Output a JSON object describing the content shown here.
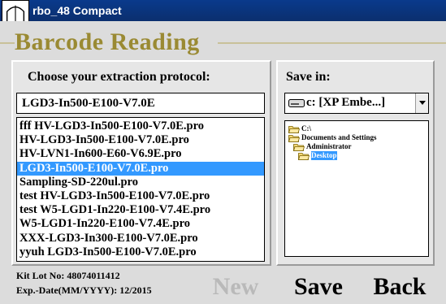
{
  "window": {
    "title": "rbo_48 Compact"
  },
  "header": {
    "title": "Barcode Reading"
  },
  "protocol_panel": {
    "label": "Choose your extraction protocol:",
    "current_value": "LGD3-In500-E100-V7.0E",
    "items": [
      "fff HV-LGD3-In500-E100-V7.0E.pro",
      "HV-LGD3-In500-E100-V7.0E.pro",
      "HV-LVN1-In600-E60-V6.9E.pro",
      "LGD3-In500-E100-V7.0E.pro",
      "Sampling-SD-220ul.pro",
      "test HV-LGD3-In500-E100-V7.0E.pro",
      "test W5-LGD1-In220-E100-V7.4E.pro",
      "W5-LGD1-In220-E100-V7.4E.pro",
      "XXX-LGD3-In300-E100-V7.0E.pro",
      "yyuh LGD3-In500-E100-V7.0E.pro"
    ],
    "selected_index": 3
  },
  "save_panel": {
    "label": "Save in:",
    "drive_value": "c: [XP Embe...]",
    "drive_icon": "drive-icon",
    "tree": [
      {
        "label": "C:\\",
        "indent": 0,
        "icon": "open-folder-icon"
      },
      {
        "label": "Documents and Settings",
        "indent": 1,
        "icon": "open-folder-icon"
      },
      {
        "label": "Administrator",
        "indent": 2,
        "icon": "open-folder-icon"
      },
      {
        "label": "Desktop",
        "indent": 3,
        "icon": "open-folder-icon",
        "selected": true
      }
    ]
  },
  "kit": {
    "lot_text": "Kit Lot No: 48074011412",
    "exp_text": "Exp.-Date(MM/YYYY): 12/2015"
  },
  "buttons": {
    "new_label": "New",
    "save_label": "Save",
    "back_label": "Back"
  },
  "colors": {
    "titlebar": "#0b2f6e",
    "header_title": "#9a8a33",
    "selection": "#3399ff",
    "disabled": "#b9b9b9"
  }
}
